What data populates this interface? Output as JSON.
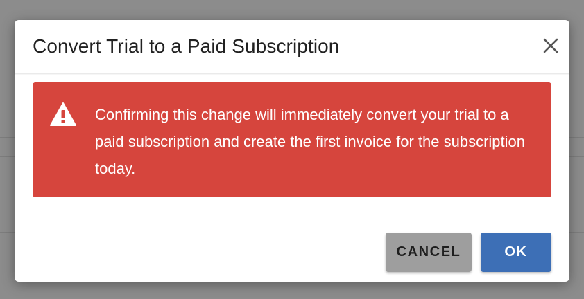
{
  "dialog": {
    "title": "Convert Trial to a Paid Subscription",
    "close_icon": "close-icon"
  },
  "alert": {
    "icon": "warning-triangle-icon",
    "message": "Confirming this change will immediately convert your trial to a paid subscription and create the first invoice for the subscription today.",
    "background_color": "#d6453d"
  },
  "actions": {
    "cancel_label": "CANCEL",
    "ok_label": "OK",
    "ok_color": "#3d6fb6",
    "cancel_color": "#9e9e9e"
  }
}
